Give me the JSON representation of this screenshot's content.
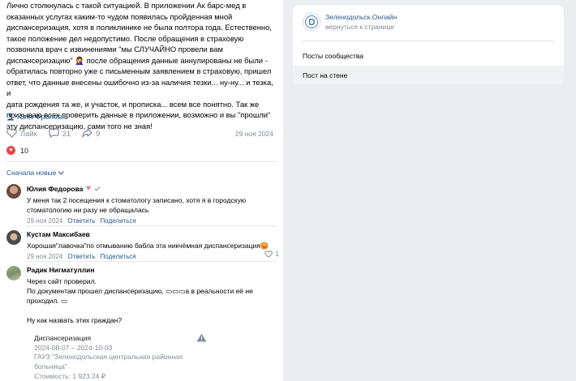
{
  "post": {
    "text": "Лично столкнулась с такой ситуацией. В приложении Ак барс-мед в\nоказанных услугах каким-то чудом появилась пройденная мной\nдиспансеризация, хотя в поликлинике не была полтора года. Естественно,\nтакое положение дел недопустимо. После обращения в страховую\nпозвонила врач с извинениями \"мы СЛУЧАЙНО провели вам\nдиспансеризацию\" 🤦‍♀️ после обращения данные аннулированы не были -\nобратилась повторно уже с письменным заявлением в страховую, пришел\nответ, что данные внесены ошибочно из-за наличия тезки... ну-ну... и тезка, и\nдата рождения та же, и участок, и прописка... всем все понятно. Так же\nпризываю всех проверить данные в приложении, возможно и вы \"прошли\"\nэту диспансеризацию, сами того не зная!",
    "author": "Юля Фролова",
    "like_label": "Лайк",
    "comments_count": "21",
    "shares_count": "9",
    "date": "29 ноя 2024",
    "reactions_count": "10",
    "sort_label": "Сначала новые"
  },
  "comments": [
    {
      "name": "Юлия Федорова",
      "text": "У меня так 2 посещения к стоматологу записано, хотя я в городскую\nстоматологию ни разу не обращалась",
      "date": "29 ноя 2024",
      "reply": "Ответить",
      "share": "Поделиться"
    },
    {
      "name": "Кустам Максибаев",
      "text": "Хорошая\"лавочка\"по отмыванию бабла эта никчёмная диспансеризация😡",
      "date": "29 ноя 2024",
      "reply": "Ответить",
      "share": "Поделиться",
      "likes": "1"
    },
    {
      "name": "Радик Нигматуллин",
      "text": "Через сайт проверил.\nПо документам прошел диспансеризацию, ▭▭▭а в реальности её не\nпроходил. ▭\n\nНу как назвать этих граждан?",
      "attachment": {
        "title": "Диспансеризация",
        "dates": "2024-08-07 – 2024-10-03",
        "org": "ГАУЗ \"Зеленодольская центральная районная\nбольница\"",
        "cost": "Стоимость: 1 923.24 ₽"
      }
    }
  ],
  "sidebar": {
    "group_name": "Зеленодольск.Онлайн",
    "back_label": "вернуться к странице",
    "items": [
      {
        "label": "Посты сообщества"
      },
      {
        "label": "Пост на стене"
      }
    ]
  },
  "colors": {
    "link": "#2a5885",
    "muted": "#818c99",
    "heart": "#e64646",
    "background": "#ebedf0"
  }
}
